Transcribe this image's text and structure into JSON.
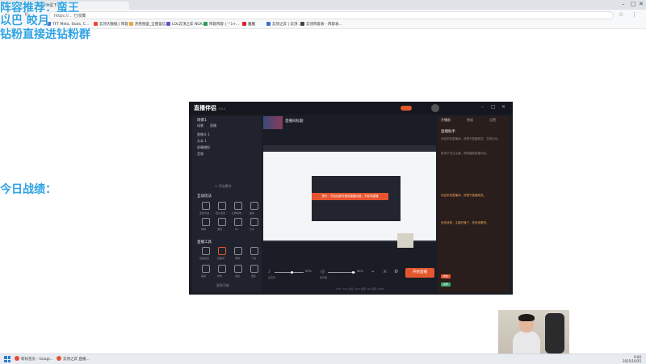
{
  "browser": {
    "tab_title": "直播伴侣下载...",
    "url": "https://...  已收藏",
    "bookmarks": [
      "TFT Meta, Stats, C...",
      "云顶大数据 | 阵容",
      "热卷图鉴_全图鉴信...",
      "LOL云顶之弈 NGA...",
      "阵容阵容 | '-'1+...",
      "魔魔",
      "云顶之弈 | 云顶...",
      "云顶阵容表 - 阵容表..."
    ],
    "bookmark_colors": [
      "#3b6fd4",
      "#e84a3c",
      "#f2a43a",
      "#6a4fc9",
      "#2c9c5a",
      "#d23",
      "#3b6fd4",
      "#444"
    ]
  },
  "overlay": {
    "line1": "阵容推荐：蛮王",
    "line2": "以巴 皎月",
    "line3": "钻粉直接进钻粉群",
    "line4": "今日战绩："
  },
  "app": {
    "logo": "直播伴侣",
    "version": "5.5.4",
    "user": "直播伴侣",
    "left": {
      "section1": "场景1",
      "scene_tabs": [
        "场景",
        "直播"
      ],
      "sources": [
        "图像头 1",
        "文本 1",
        "屏幕捕捉",
        "音频"
      ],
      "add_source": "+ 添加素材",
      "section2": "互动玩法",
      "tools_title": "直播工具",
      "interact_icons": [
        "连线对战",
        "观众连线",
        "礼物特效",
        "抽奖",
        "弹幕",
        "游戏",
        "PK",
        "分享"
      ],
      "tool_icons": [
        "直播设置",
        "直播间",
        "录制",
        "下载",
        "美颜",
        "特效",
        "滤镜",
        "更多"
      ],
      "more": "更多功能"
    },
    "center": {
      "stream_title": "直播间标题",
      "toast": "提示：开启后即可使用直播功能，不影响直播",
      "mic_label": "麦克风",
      "mic_value": "50%",
      "speaker_label": "扬声器",
      "speaker_value": "90%",
      "start_button": "开始直播",
      "status": "CPU: 21%   内存: 40%   帧率: 60   码率: 6000"
    },
    "right": {
      "tabs": [
        "开播前",
        "数据",
        "设置"
      ],
      "assistant": "直播助手",
      "notice": "欢迎来到直播间，请遵守直播规范，文明互动。",
      "announce": "新用户关注主播，获取最新直播动态。",
      "chat1": "欢迎来到直播间，请遵守直播规范。",
      "chat2": "系统消息：主播开播了，快来观看吧。",
      "badges": [
        "粉丝",
        "钻粉"
      ]
    }
  },
  "taskbar": {
    "items": [
      "新标签页 - Googl...",
      "云顶之弈 直播..."
    ],
    "time": "9:00",
    "date": "2025/10/25"
  }
}
